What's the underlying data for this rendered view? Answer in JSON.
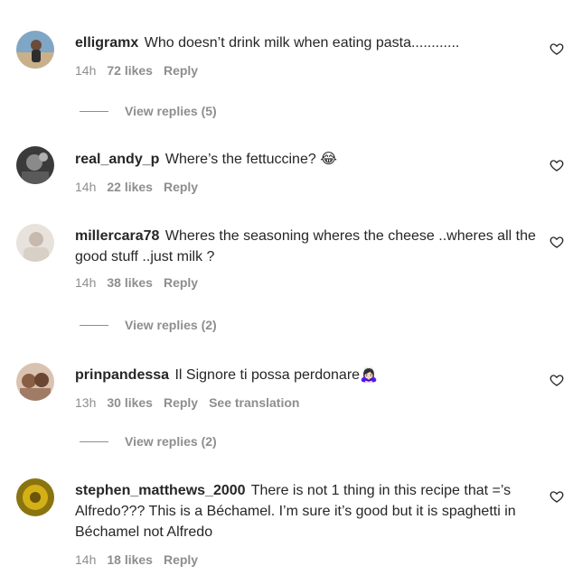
{
  "comments": [
    {
      "username": "elligramx",
      "text": "Who doesn’t drink milk when eating pasta............",
      "time": "14h",
      "likes": "72 likes",
      "reply": "Reply",
      "view_replies": "View replies (5)"
    },
    {
      "username": "real_andy_p",
      "text": "Where’s the fettuccine? 😂",
      "time": "14h",
      "likes": "22 likes",
      "reply": "Reply"
    },
    {
      "username": "millercara78",
      "text": "Wheres the seasoning wheres the cheese ..wheres all the good stuff ..just milk ?",
      "time": "14h",
      "likes": "38 likes",
      "reply": "Reply",
      "view_replies": "View replies (2)"
    },
    {
      "username": "prinpandessa",
      "text": "Il Signore ti possa perdonare🙇🏻‍♀️",
      "time": "13h",
      "likes": "30 likes",
      "reply": "Reply",
      "see_translation": "See translation",
      "view_replies": "View replies (2)"
    },
    {
      "username": "stephen_matthews_2000",
      "text": "There is not 1 thing in this recipe that =’s Alfredo??? This is a Béchamel. I’m sure it’s good but it is spaghetti in Béchamel not Alfredo",
      "time": "14h",
      "likes": "18 likes",
      "reply": "Reply"
    }
  ],
  "icons": {
    "like": "heart-outline-icon"
  },
  "colors": {
    "text": "#262626",
    "muted": "#8e8e8e"
  }
}
